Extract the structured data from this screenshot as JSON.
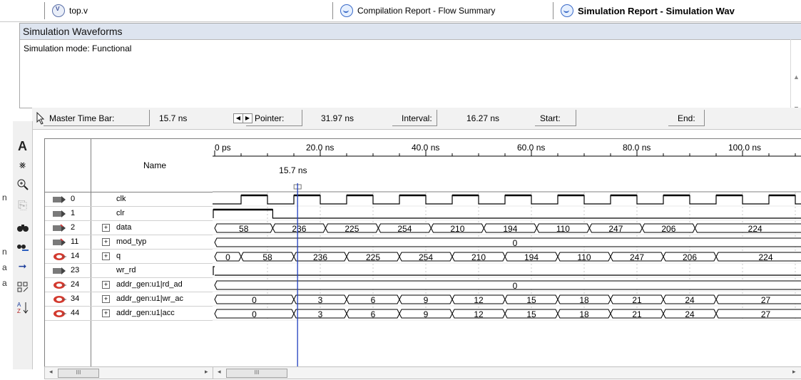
{
  "tabs": [
    {
      "label": "top.v",
      "icon": "verilog-file-icon"
    },
    {
      "label": "Compilation Report - Flow Summary",
      "icon": "report-icon"
    },
    {
      "label": "Simulation Report - Simulation Wav",
      "icon": "report-icon"
    }
  ],
  "edge_fragments": [
    "n",
    "n",
    "a",
    "a"
  ],
  "report": {
    "title": "Simulation Waveforms",
    "mode": "Simulation mode: Functional"
  },
  "timebar": {
    "master_label": "Master Time Bar:",
    "master_value": "15.7 ns",
    "pointer_label": "Pointer:",
    "pointer_value": "31.97 ns",
    "interval_label": "Interval:",
    "interval_value": "16.27 ns",
    "start_label": "Start:",
    "start_value": "",
    "end_label": "End:",
    "end_value": ""
  },
  "tools": [
    "pointer-tool-icon",
    "text-tool-icon",
    "waveform-edit-icon",
    "zoom-icon",
    "copy-icon",
    "find-icon",
    "find-next-icon",
    "arrow-right-icon",
    "group-icon",
    "sort-icon"
  ],
  "name_header": "Name",
  "time_scale": {
    "labels": [
      "0 ps",
      "20.0 ns",
      "40.0 ns",
      "60.0 ns",
      "80.0 ns",
      "100.0 ns"
    ],
    "marker_label": "15.7 ns",
    "marker_time": 15.7
  },
  "signals": [
    {
      "num": "0",
      "name": "clk",
      "expand": false,
      "pin": "input"
    },
    {
      "num": "1",
      "name": "clr",
      "expand": false,
      "pin": "input"
    },
    {
      "num": "2",
      "name": "data",
      "expand": true,
      "pin": "input-bus"
    },
    {
      "num": "11",
      "name": "mod_typ",
      "expand": true,
      "pin": "input-bus"
    },
    {
      "num": "14",
      "name": "q",
      "expand": true,
      "pin": "output"
    },
    {
      "num": "23",
      "name": "wr_rd",
      "expand": false,
      "pin": "input"
    },
    {
      "num": "24",
      "name": "addr_gen:u1|rd_ad",
      "expand": true,
      "pin": "output"
    },
    {
      "num": "34",
      "name": "addr_gen:u1|wr_ac",
      "expand": true,
      "pin": "output"
    },
    {
      "num": "44",
      "name": "addr_gen:u1|acc",
      "expand": true,
      "pin": "output"
    }
  ],
  "bus_values": {
    "data": [
      "58",
      "236",
      "225",
      "254",
      "210",
      "194",
      "110",
      "247",
      "206",
      "224"
    ],
    "mod_typ": [
      "0"
    ],
    "q": [
      "0",
      "58",
      "236",
      "225",
      "254",
      "210",
      "194",
      "110",
      "247",
      "206",
      "224"
    ],
    "rd_ad": [
      "0"
    ],
    "wr_ac": [
      "0",
      "3",
      "6",
      "9",
      "12",
      "15",
      "18",
      "21",
      "24",
      "27"
    ],
    "acc": [
      "0",
      "3",
      "6",
      "9",
      "12",
      "15",
      "18",
      "21",
      "24",
      "27"
    ]
  },
  "scroll_thumb_label": "III"
}
